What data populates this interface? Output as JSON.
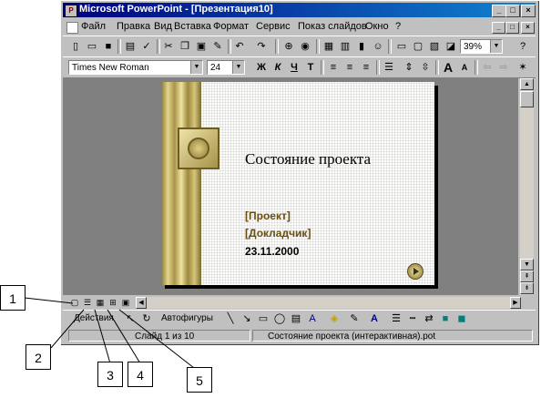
{
  "window": {
    "title": "Microsoft PowerPoint - [Презентация10]",
    "min_glyph": "_",
    "max_glyph": "□",
    "close_glyph": "×"
  },
  "menu": {
    "items": [
      "Файл",
      "Правка",
      "Вид",
      "Вставка",
      "Формат",
      "Сервис",
      "Показ слайдов",
      "Окно",
      "?"
    ]
  },
  "standard_toolbar": {
    "zoom": "39%",
    "help_glyph": "?"
  },
  "format_toolbar": {
    "font": "Times New Roman",
    "size": "24",
    "bold": "Ж",
    "italic": "К",
    "underline": "Ч",
    "shadow": "Т",
    "grow_font": "A",
    "shrink_font": "A"
  },
  "slide": {
    "title": "Состояние проекта",
    "project": "[Проект]",
    "presenter": "[Докладчик]",
    "date": "23.11.2000",
    "text_color": "#6b4f10"
  },
  "drawing_toolbar": {
    "actions": "Действия",
    "autoshapes": "Автофигуры"
  },
  "status": {
    "slide": "Слайд 1 из 10",
    "template": "Состояние проекта (интерактивная).pot"
  },
  "callouts": [
    "1",
    "2",
    "3",
    "4",
    "5"
  ]
}
